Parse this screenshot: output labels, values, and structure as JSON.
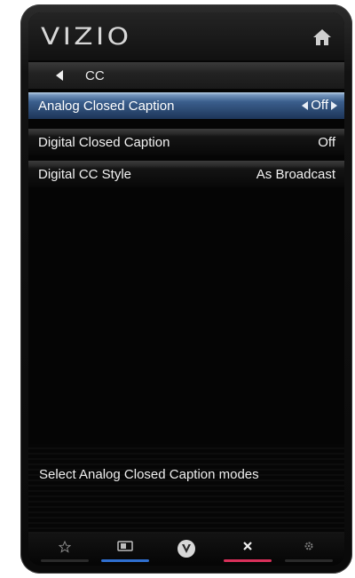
{
  "header": {
    "logo_text": "VIZIO",
    "home_icon": "home-icon"
  },
  "breadcrumb": {
    "back_icon": "left-triangle-icon",
    "title": "CC"
  },
  "menu": {
    "items": [
      {
        "label": "Analog Closed Caption",
        "value": "Off",
        "selected": true
      },
      {
        "label": "Digital Closed Caption",
        "value": "Off",
        "selected": false
      },
      {
        "label": "Digital CC Style",
        "value": "As Broadcast",
        "selected": false
      }
    ]
  },
  "description": "Select Analog Closed Caption modes",
  "footer": {
    "buttons": [
      {
        "name": "star-icon",
        "color": ""
      },
      {
        "name": "widget-icon",
        "color": "#2f6fd0"
      },
      {
        "name": "vizio-v-icon",
        "color": ""
      },
      {
        "name": "close-icon",
        "color": "#d9305a"
      },
      {
        "name": "gear-icon",
        "color": ""
      }
    ]
  },
  "colors": {
    "selected_row": "#3b5f8d",
    "background": "#050505",
    "text": "#f2f2f2"
  }
}
